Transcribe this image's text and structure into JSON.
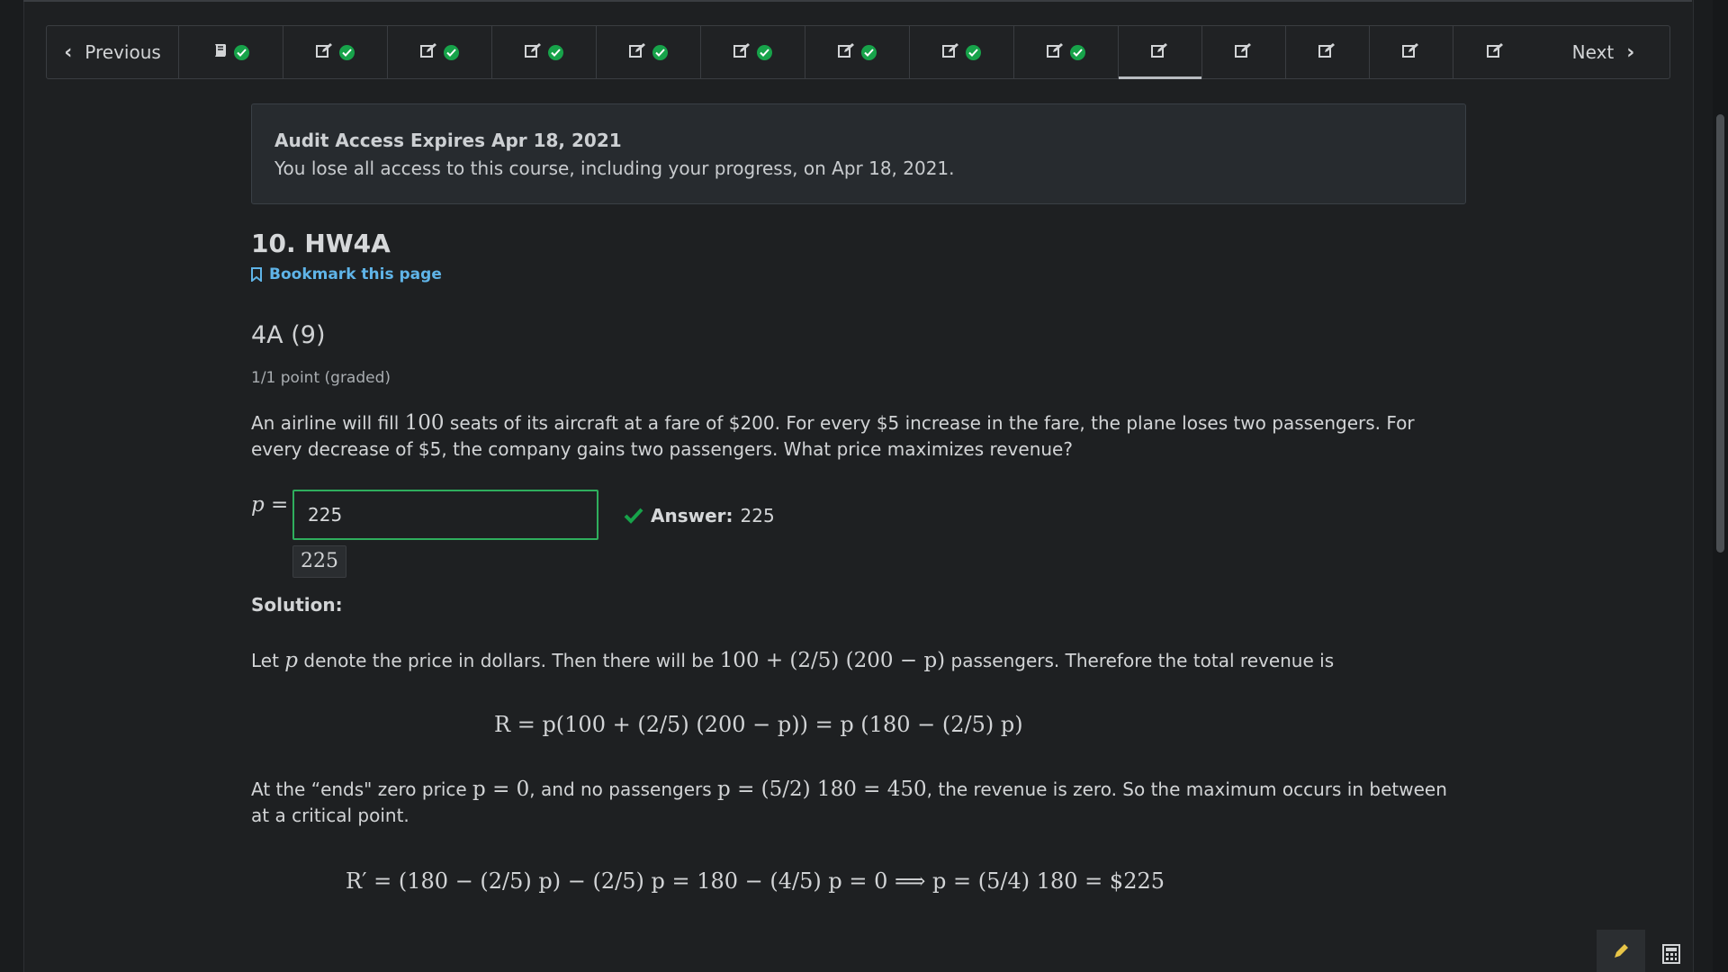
{
  "nav": {
    "prev_label": "Previous",
    "next_label": "Next",
    "units": [
      {
        "icon": "book-icon",
        "completed": true
      },
      {
        "icon": "edit-icon",
        "completed": true
      },
      {
        "icon": "edit-icon",
        "completed": true
      },
      {
        "icon": "edit-icon",
        "completed": true
      },
      {
        "icon": "edit-icon",
        "completed": true
      },
      {
        "icon": "edit-icon",
        "completed": true
      },
      {
        "icon": "edit-icon",
        "completed": true
      },
      {
        "icon": "edit-icon",
        "completed": true
      },
      {
        "icon": "edit-icon",
        "completed": true
      },
      {
        "icon": "edit-icon",
        "completed": false,
        "active": true
      },
      {
        "icon": "edit-icon",
        "completed": false
      },
      {
        "icon": "edit-icon",
        "completed": false
      },
      {
        "icon": "edit-icon",
        "completed": false
      },
      {
        "icon": "edit-icon",
        "completed": false
      }
    ]
  },
  "audit": {
    "title": "Audit Access Expires Apr 18, 2021",
    "text": "You lose all access to this course, including your progress, on Apr 18, 2021."
  },
  "unit": {
    "title": "10. HW4A",
    "bookmark_label": "Bookmark this page"
  },
  "problem": {
    "title": "4A (9)",
    "points": "1/1 point (graded)",
    "question_a": "An airline will fill ",
    "question_num": "100",
    "question_b": " seats of its aircraft at a fare of $200. For every $5 increase in the fare, the plane loses two passengers. For every decrease of $5, the company gains two passengers. What price maximizes revenue?",
    "input_label": "p =",
    "input_value": "225",
    "preview_value": "225",
    "answer_label": "Answer:",
    "answer_value": "225"
  },
  "solution": {
    "heading": "Solution:",
    "p1_a": "Let ",
    "p1_var": "p",
    "p1_b": " denote the price in dollars. Then there will be ",
    "p1_expr": "100 + (2/5) (200 − p)",
    "p1_c": " passengers. Therefore the total revenue is",
    "eq1": "R = p(100 + (2/5) (200 − p)) = p (180 − (2/5) p)",
    "p2_a": "At the “ends\" zero price ",
    "p2_expr1": "p = 0",
    "p2_b": ", and no passengers ",
    "p2_expr2": "p = (5/2) 180 = 450",
    "p2_c": ", the revenue is zero. So the maximum occurs in between at a critical point.",
    "eq2": "R′ = (180 − (2/5) p) − (2/5) p = 180 − (4/5) p = 0  ⟹  p = (5/4) 180 = $225"
  },
  "colors": {
    "accent_link": "#5fb4e8",
    "success": "#17a34a",
    "input_border": "#2fae5d"
  }
}
